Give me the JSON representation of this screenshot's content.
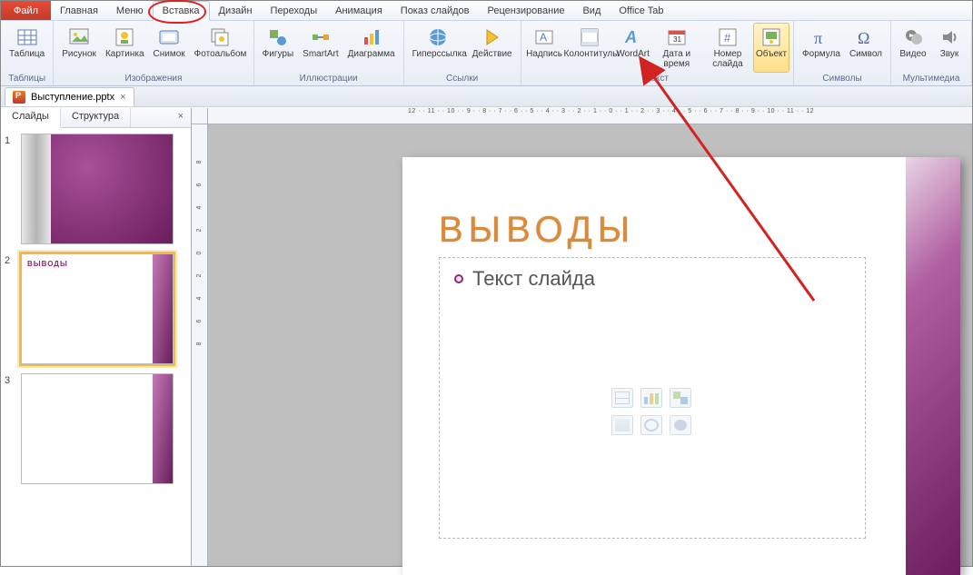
{
  "tabs": {
    "file": "Файл",
    "items": [
      "Главная",
      "Меню",
      "Вставка",
      "Дизайн",
      "Переходы",
      "Анимация",
      "Показ слайдов",
      "Рецензирование",
      "Вид",
      "Office Tab"
    ],
    "active": "Вставка",
    "circled": "Вставка"
  },
  "ribbon_groups": [
    {
      "label": "Таблицы",
      "buttons": [
        {
          "id": "table",
          "label": "Таблица"
        }
      ]
    },
    {
      "label": "Изображения",
      "buttons": [
        {
          "id": "picture",
          "label": "Рисунок"
        },
        {
          "id": "clipart",
          "label": "Картинка"
        },
        {
          "id": "screenshot",
          "label": "Снимок"
        },
        {
          "id": "album",
          "label": "Фотоальбом"
        }
      ]
    },
    {
      "label": "Иллюстрации",
      "buttons": [
        {
          "id": "shapes",
          "label": "Фигуры"
        },
        {
          "id": "smartart",
          "label": "SmartArt"
        },
        {
          "id": "chart",
          "label": "Диаграмма"
        }
      ]
    },
    {
      "label": "Ссылки",
      "buttons": [
        {
          "id": "hyperlink",
          "label": "Гиперссылка"
        },
        {
          "id": "action",
          "label": "Действие"
        }
      ]
    },
    {
      "label": "Текст",
      "buttons": [
        {
          "id": "textbox",
          "label": "Надпись"
        },
        {
          "id": "headerfooter",
          "label": "Колонтитулы"
        },
        {
          "id": "wordart",
          "label": "WordArt"
        },
        {
          "id": "datetime",
          "label": "Дата и время"
        },
        {
          "id": "slidenum",
          "label": "Номер слайда"
        },
        {
          "id": "object",
          "label": "Объект",
          "highlighted": true
        }
      ]
    },
    {
      "label": "Символы",
      "buttons": [
        {
          "id": "equation",
          "label": "Формула"
        },
        {
          "id": "symbol",
          "label": "Символ"
        }
      ]
    },
    {
      "label": "Мультимедиа",
      "buttons": [
        {
          "id": "video",
          "label": "Видео"
        },
        {
          "id": "audio",
          "label": "Звук"
        }
      ]
    }
  ],
  "doc_tab": {
    "filename": "Выступление.pptx"
  },
  "side_panel": {
    "tabs": {
      "slides": "Слайды",
      "outline": "Структура"
    },
    "thumbs": [
      {
        "num": "1"
      },
      {
        "num": "2",
        "title": "ВЫВОДЫ",
        "selected": true
      },
      {
        "num": "3"
      }
    ]
  },
  "slide": {
    "title": "ВЫВОДЫ",
    "content_placeholder": "Текст слайда"
  },
  "hruler_text": "12 · · 11 · · 10 · · 9 · · 8 · · 7 · · 6 · · 5 · · 4 · · 3 · · 2 · · 1 · · 0 · · 1 · · 2 · · 3 · · 4 · · 5 · · 6 · · 7 · · 8 · · 9 · · 10 · · 11 · · 12",
  "colors": {
    "file_tab": "#cf3b2b",
    "title_accent": "#d98a3a",
    "theme_purple": "#6b1d5d",
    "highlight": "#ffe08a",
    "annotation": "#d22323"
  }
}
